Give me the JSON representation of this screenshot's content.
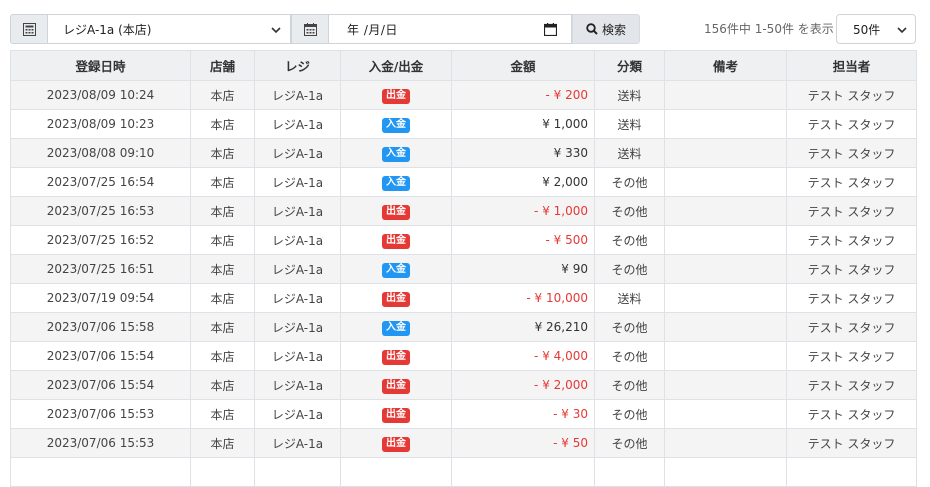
{
  "toolbar": {
    "register_icon": "calculator-icon",
    "register_select": "レジA-1a (本店)",
    "date_icon": "calendar-icon",
    "date_placeholder": "年 /月/日",
    "search_label": "検索",
    "count_text": "156件中 1-50件 を表示",
    "per_page": "50件"
  },
  "table": {
    "headers": [
      "登録日時",
      "店舗",
      "レジ",
      "入金/出金",
      "金額",
      "分類",
      "備考",
      "担当者"
    ],
    "rows": [
      {
        "datetime": "2023/08/09 10:24",
        "store": "本店",
        "register": "レジA-1a",
        "type": "出金",
        "amount": "- ¥ 200",
        "category": "送料",
        "note": "",
        "staff": "テスト スタッフ"
      },
      {
        "datetime": "2023/08/09 10:23",
        "store": "本店",
        "register": "レジA-1a",
        "type": "入金",
        "amount": "¥ 1,000",
        "category": "送料",
        "note": "",
        "staff": "テスト スタッフ"
      },
      {
        "datetime": "2023/08/08 09:10",
        "store": "本店",
        "register": "レジA-1a",
        "type": "入金",
        "amount": "¥ 330",
        "category": "送料",
        "note": "",
        "staff": "テスト スタッフ"
      },
      {
        "datetime": "2023/07/25 16:54",
        "store": "本店",
        "register": "レジA-1a",
        "type": "入金",
        "amount": "¥ 2,000",
        "category": "その他",
        "note": "",
        "staff": "テスト スタッフ"
      },
      {
        "datetime": "2023/07/25 16:53",
        "store": "本店",
        "register": "レジA-1a",
        "type": "出金",
        "amount": "- ¥ 1,000",
        "category": "その他",
        "note": "",
        "staff": "テスト スタッフ"
      },
      {
        "datetime": "2023/07/25 16:52",
        "store": "本店",
        "register": "レジA-1a",
        "type": "出金",
        "amount": "- ¥ 500",
        "category": "その他",
        "note": "",
        "staff": "テスト スタッフ"
      },
      {
        "datetime": "2023/07/25 16:51",
        "store": "本店",
        "register": "レジA-1a",
        "type": "入金",
        "amount": "¥ 90",
        "category": "その他",
        "note": "",
        "staff": "テスト スタッフ"
      },
      {
        "datetime": "2023/07/19 09:54",
        "store": "本店",
        "register": "レジA-1a",
        "type": "出金",
        "amount": "- ¥ 10,000",
        "category": "送料",
        "note": "",
        "staff": "テスト スタッフ"
      },
      {
        "datetime": "2023/07/06 15:58",
        "store": "本店",
        "register": "レジA-1a",
        "type": "入金",
        "amount": "¥ 26,210",
        "category": "その他",
        "note": "",
        "staff": "テスト スタッフ"
      },
      {
        "datetime": "2023/07/06 15:54",
        "store": "本店",
        "register": "レジA-1a",
        "type": "出金",
        "amount": "- ¥ 4,000",
        "category": "その他",
        "note": "",
        "staff": "テスト スタッフ"
      },
      {
        "datetime": "2023/07/06 15:54",
        "store": "本店",
        "register": "レジA-1a",
        "type": "出金",
        "amount": "- ¥ 2,000",
        "category": "その他",
        "note": "",
        "staff": "テスト スタッフ"
      },
      {
        "datetime": "2023/07/06 15:53",
        "store": "本店",
        "register": "レジA-1a",
        "type": "出金",
        "amount": "- ¥ 30",
        "category": "その他",
        "note": "",
        "staff": "テスト スタッフ"
      },
      {
        "datetime": "2023/07/06 15:53",
        "store": "本店",
        "register": "レジA-1a",
        "type": "出金",
        "amount": "- ¥ 50",
        "category": "その他",
        "note": "",
        "staff": "テスト スタッフ"
      },
      {
        "datetime": "",
        "store": "",
        "register": "",
        "type": "",
        "amount": "",
        "category": "",
        "note": "",
        "staff": ""
      }
    ]
  },
  "colors": {
    "out_badge": "#e53935",
    "in_badge": "#2196f3",
    "negative_amount": "#e53935"
  }
}
